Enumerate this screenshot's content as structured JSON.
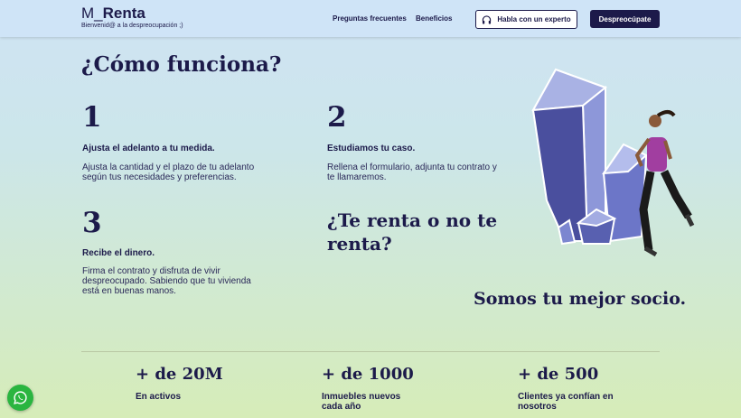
{
  "header": {
    "logo_m": "M_",
    "logo_renta": "Renta",
    "tagline": "Bienvenid@ a la despreocupación ;)",
    "nav": [
      "Preguntas frecuentes",
      "Beneficios"
    ],
    "expert_button": "Habla con un experto",
    "cta_button": "Despreocúpate"
  },
  "main": {
    "title": "¿Cómo funciona?",
    "steps": [
      {
        "num": "1",
        "title": "Ajusta el adelanto a tu medida.",
        "desc": "Ajusta la cantidad y el plazo de tu adelanto según tus necesidades y preferencias."
      },
      {
        "num": "2",
        "title": "Estudiamos tu caso.",
        "desc": "Rellena el formulario, adjunta tu contrato y te llamaremos."
      },
      {
        "num": "3",
        "title": "Recibe el dinero.",
        "desc": "Firma el contrato y disfruta de vivir despreocupado. Sabiendo que tu vivienda está en buenas manos."
      }
    ],
    "question": "¿Te renta o no te renta?",
    "partner": "Somos tu mejor socio."
  },
  "stats": [
    {
      "value": "+ de 20M",
      "label": "En activos"
    },
    {
      "value": "+ de 1000",
      "label": "Inmuebles nuevos cada año"
    },
    {
      "value": "+ de 500",
      "label": "Clientes ya confían en nosotros"
    }
  ],
  "icons": {
    "expert": "headphones-icon",
    "chat": "whatsapp-icon"
  },
  "colors": {
    "brand": "#1c1a4a",
    "whatsapp": "#2ab540",
    "crystal": "#6b74c4"
  }
}
